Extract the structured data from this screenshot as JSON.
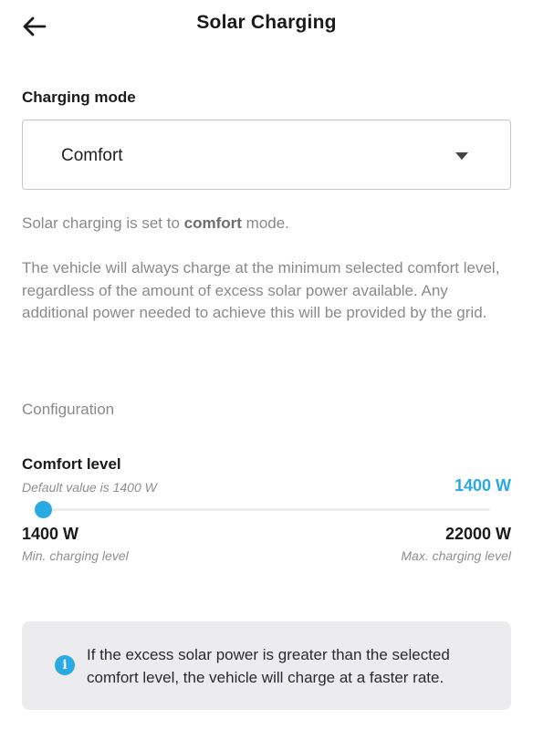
{
  "header": {
    "title": "Solar Charging",
    "back_icon": "arrow-left-icon"
  },
  "charging_mode": {
    "label": "Charging mode",
    "selected": "Comfort",
    "caret_icon": "chevron-down-icon"
  },
  "description": {
    "prefix": "Solar charging is set to ",
    "mode_word": "comfort",
    "suffix": " mode.",
    "detail": "The vehicle will always charge at the minimum selected comfort level, regardless of the amount of excess solar power available. Any additional power needed to achieve this will be provided by the grid."
  },
  "configuration": {
    "label": "Configuration"
  },
  "comfort_level": {
    "title": "Comfort level",
    "default_hint": "Default value is 1400 W",
    "current_value": "1400 W",
    "current": 1400,
    "min": 1400,
    "max": 22000,
    "min_label": "1400 W",
    "max_label": "22000 W",
    "min_caption": "Min. charging level",
    "max_caption": "Max. charging level"
  },
  "info": {
    "icon": "info-icon",
    "text": "If the excess solar power is greater than the selected comfort level, the vehicle will charge at a faster rate."
  },
  "colors": {
    "accent": "#2aaae2",
    "info_background": "#ececee",
    "muted_text": "#8a8a8a"
  }
}
